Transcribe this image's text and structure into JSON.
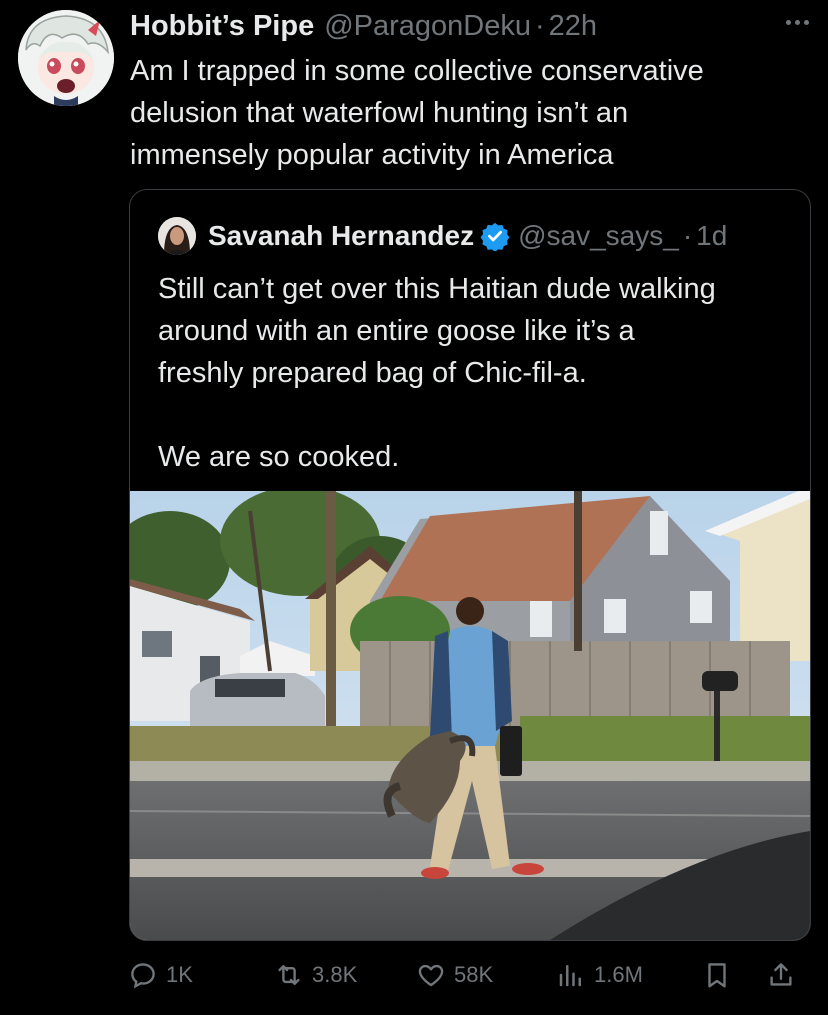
{
  "tweet": {
    "author_name": "Hobbit’s Pipe",
    "author_handle": "@ParagonDeku",
    "separator": "·",
    "time": "22h",
    "text": "Am I trapped in some collective conservative\ndelusion that waterfowl hunting isn’t an\nimmensely popular activity in America"
  },
  "quoted_tweet": {
    "author_name": "Savanah Hernandez",
    "author_handle": "@sav_says_",
    "separator": "·",
    "time": "1d",
    "verified_badge_color": "#1d9bf0",
    "text": "Still can’t get over this Haitian dude walking\naround with an entire goose like it’s a\nfreshly prepared bag of Chic-fil-a.\n\nWe are so cooked."
  },
  "actions": {
    "replies": "1K",
    "reposts": "3.8K",
    "likes": "58K",
    "views": "1.6M"
  },
  "icons": [
    "more-icon",
    "reply-icon",
    "repost-icon",
    "like-icon",
    "views-icon",
    "bookmark-icon",
    "share-icon",
    "verified-badge-icon"
  ]
}
